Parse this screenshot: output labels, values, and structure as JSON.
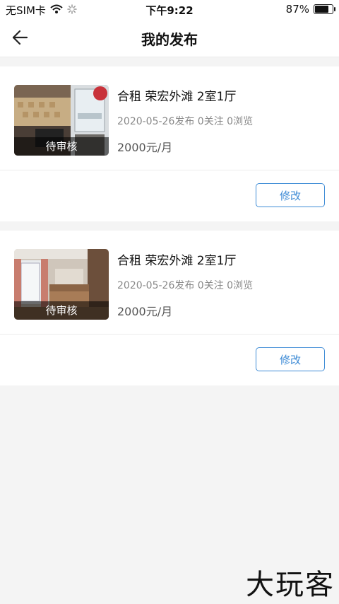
{
  "status_bar": {
    "carrier": "无SIM卡",
    "time": "下午9:22",
    "battery": "87%",
    "battery_level": 0.87
  },
  "nav": {
    "title": "我的发布"
  },
  "listings": [
    {
      "status": "待审核",
      "title": "合租 荣宏外滩 2室1厅",
      "meta": "2020-05-26发布 0关注 0浏览",
      "price": "2000元/月",
      "edit_label": "修改"
    },
    {
      "status": "待审核",
      "title": "合租 荣宏外滩 2室1厅",
      "meta": "2020-05-26发布 0关注 0浏览",
      "price": "2000元/月",
      "edit_label": "修改"
    }
  ],
  "watermark": "大玩客"
}
